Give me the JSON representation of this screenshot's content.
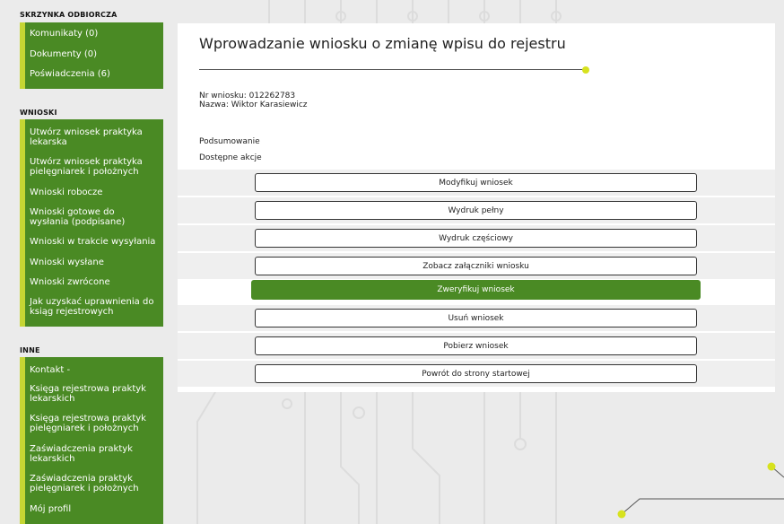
{
  "colors": {
    "menu_green": "#4a8a24",
    "accent_yellow": "#c5d633",
    "dot_yellow": "#d7e21e",
    "background": "#ebebeb"
  },
  "sidebar": {
    "inbox": {
      "title": "SKRZYNKA ODBIORCZA",
      "items": [
        {
          "label": "Komunikaty (0)"
        },
        {
          "label": "Dokumenty (0)"
        },
        {
          "label": "Poświadczenia (6)"
        }
      ]
    },
    "applications": {
      "title": "WNIOSKI",
      "items": [
        {
          "label": "Utwórz wniosek praktyka lekarska"
        },
        {
          "label": "Utwórz wniosek praktyka pielęgniarek i położnych"
        },
        {
          "label": "Wnioski robocze"
        },
        {
          "label": "Wnioski gotowe do wysłania (podpisane)"
        },
        {
          "label": "Wnioski w trakcie wysyłania"
        },
        {
          "label": "Wnioski wysłane"
        },
        {
          "label": "Wnioski zwrócone"
        },
        {
          "label": "Jak uzyskać uprawnienia do ksiąg rejestrowych"
        }
      ]
    },
    "other": {
      "title": "INNE",
      "items": [
        {
          "label": "Kontakt -"
        },
        {
          "label": "Księga rejestrowa praktyk lekarskich"
        },
        {
          "label": "Księga rejestrowa praktyk pielęgniarek i położnych"
        },
        {
          "label": "Zaświadczenia praktyk lekarskich"
        },
        {
          "label": "Zaświadczenia praktyk pielęgniarek i położnych"
        },
        {
          "label": "Mój profil"
        }
      ]
    }
  },
  "main": {
    "title": "Wprowadzanie wniosku o zmianę wpisu do rejestru",
    "application_number": "Nr wniosku: 012262783",
    "name": "Nazwa: Wiktor Karasiewicz",
    "summary_label": "Podsumowanie",
    "available_actions_label": "Dostępne akcje",
    "actions": [
      {
        "label": "Modyfikuj wniosek"
      },
      {
        "label": "Wydruk pełny"
      },
      {
        "label": "Wydruk częściowy"
      },
      {
        "label": "Zobacz załączniki wniosku"
      },
      {
        "label": "Zweryfikuj wniosek"
      },
      {
        "label": "Usuń wniosek"
      },
      {
        "label": "Pobierz wniosek"
      },
      {
        "label": "Powrót do strony startowej"
      }
    ]
  }
}
